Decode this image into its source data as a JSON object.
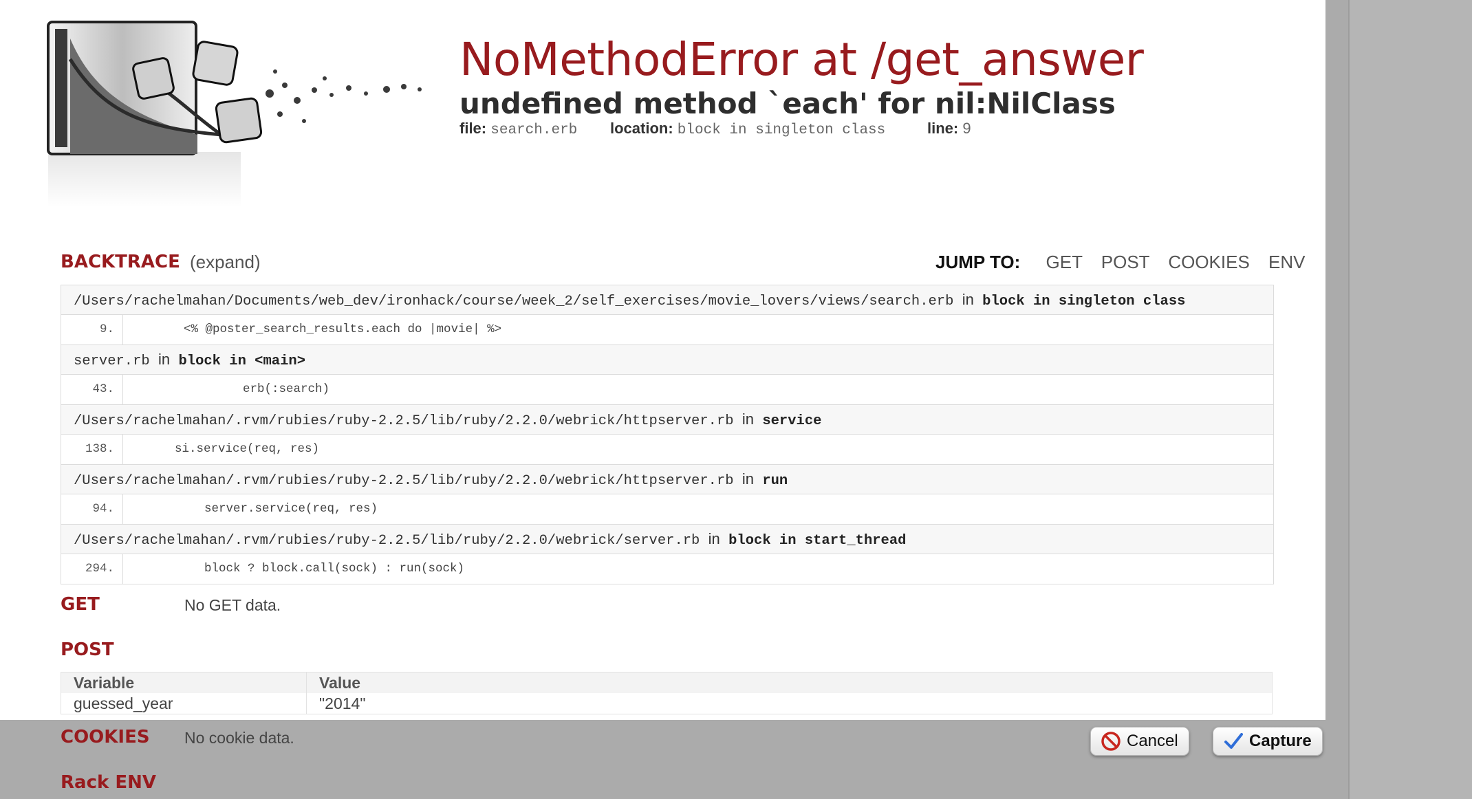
{
  "error": {
    "title": "NoMethodError at /get_answer",
    "message": "undefined method `each' for nil:NilClass",
    "file_label": "file:",
    "file_value": "search.erb",
    "location_label": "location:",
    "location_value": "block in singleton class",
    "line_label": "line:",
    "line_value": "9"
  },
  "backtrace": {
    "title": "BACKTRACE",
    "expand": "(expand)",
    "jump_label": "JUMP TO:",
    "jump_links": [
      "GET",
      "POST",
      "COOKIES",
      "ENV"
    ],
    "in_word": "in",
    "frames": [
      {
        "file": "/Users/rachelmahan/Documents/web_dev/ironhack/course/week_2/self_exercises/movie_lovers/views/search.erb",
        "func": "block in singleton class",
        "line": "9.",
        "code": "<% @poster_search_results.each do |movie| %>"
      },
      {
        "file": "server.rb",
        "func": "block in <main>",
        "line": "43.",
        "code": "erb(:search)"
      },
      {
        "file": "/Users/rachelmahan/.rvm/rubies/ruby-2.2.5/lib/ruby/2.2.0/webrick/httpserver.rb",
        "func": "service",
        "line": "138.",
        "code": "si.service(req, res)"
      },
      {
        "file": "/Users/rachelmahan/.rvm/rubies/ruby-2.2.5/lib/ruby/2.2.0/webrick/httpserver.rb",
        "func": "run",
        "line": "94.",
        "code": "server.service(req, res)"
      },
      {
        "file": "/Users/rachelmahan/.rvm/rubies/ruby-2.2.5/lib/ruby/2.2.0/webrick/server.rb",
        "func": "block in start_thread",
        "line": "294.",
        "code": "block ? block.call(sock) : run(sock)"
      }
    ]
  },
  "get": {
    "title": "GET",
    "empty": "No GET data."
  },
  "post": {
    "title": "POST",
    "col_variable": "Variable",
    "col_value": "Value",
    "rows": [
      {
        "variable": "guessed_year",
        "value": "\"2014\""
      }
    ]
  },
  "cookies": {
    "title": "COOKIES",
    "empty": "No cookie data."
  },
  "rack_env": {
    "title": "Rack ENV"
  },
  "dialog": {
    "cancel_label": "Cancel",
    "capture_label": "Capture",
    "cancel_icon": "no-entry-icon",
    "capture_icon": "checkmark-icon"
  },
  "colors": {
    "accent": "#981b1e",
    "overlay": "#ababab"
  }
}
